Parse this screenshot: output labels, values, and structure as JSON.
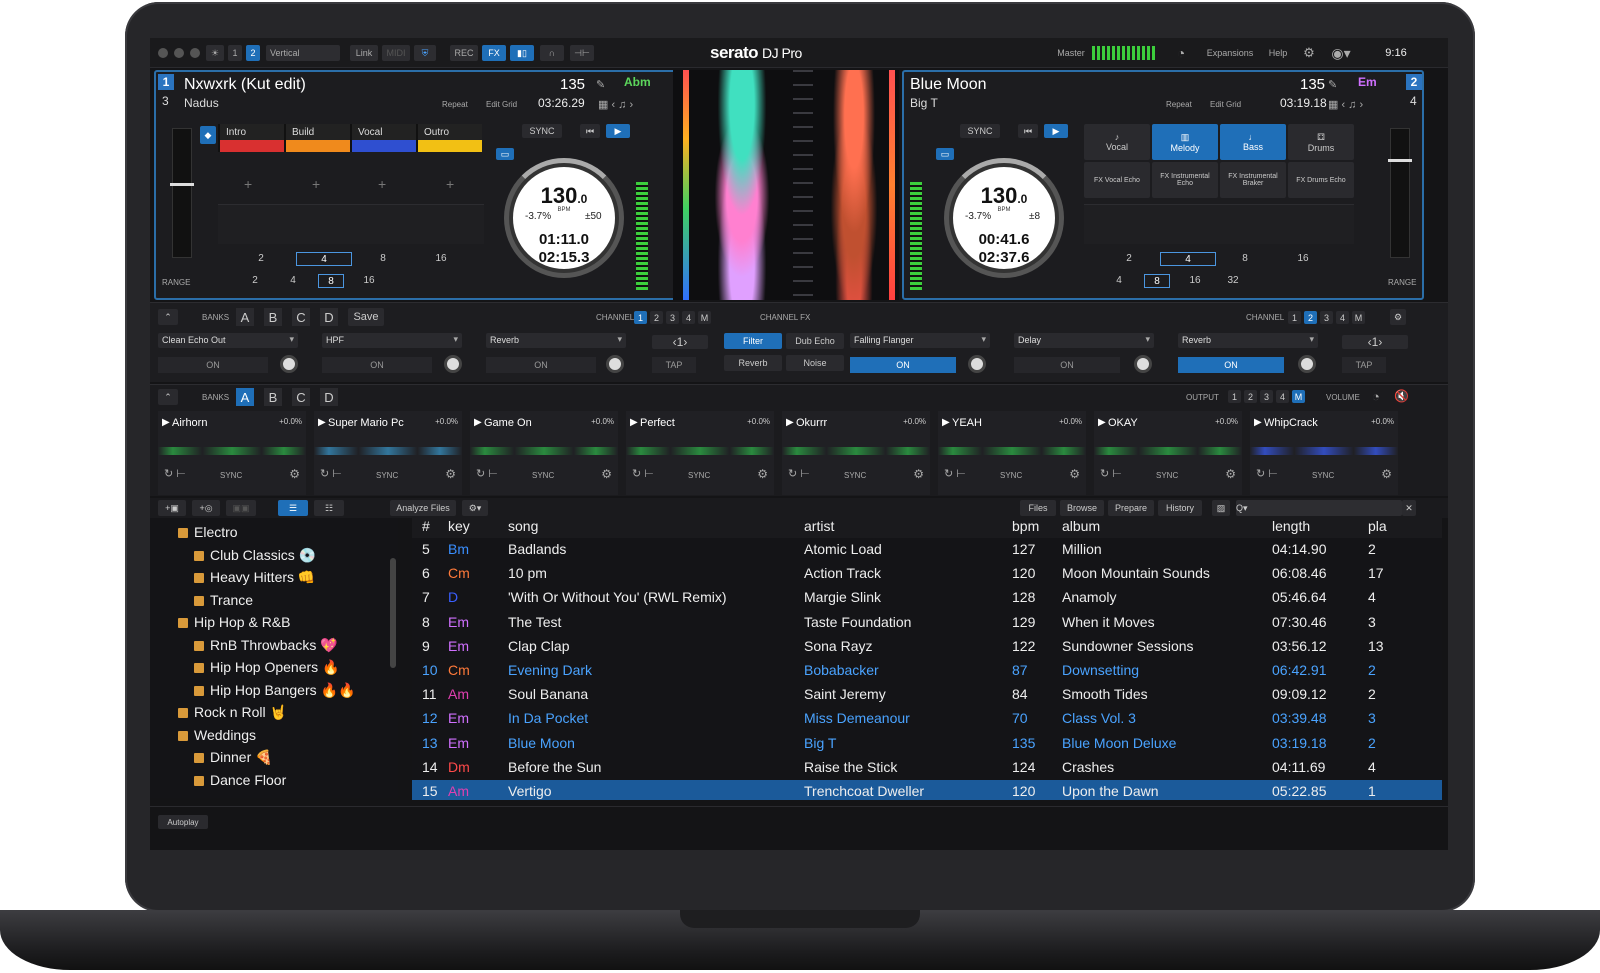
{
  "app": {
    "logo": "serato",
    "logo_suffix": "DJ Pro",
    "layout": "Vertical",
    "link": "Link",
    "midi": "MIDI",
    "rec": "REC",
    "fx": "FX",
    "master": "Master",
    "expansions": "Expansions",
    "help": "Help",
    "clock": "9:16",
    "deck_views": [
      "1",
      "2"
    ]
  },
  "deck1": {
    "num": "1",
    "num2": "3",
    "title": "Nxwxrk (Kut edit)",
    "artist": "Nadus",
    "bpm": "135",
    "key": "Abm",
    "remaining": "03:26.29",
    "repeat": "Repeat",
    "editgrid": "Edit Grid",
    "sync": "SYNC",
    "platter_bpm": "130",
    "platter_bpm_dec": ".0",
    "bpm_unit": "BPM",
    "pitch": "-3.7%",
    "range": "±50",
    "elapsed": "01:11.0",
    "remain": "02:15.3",
    "range_label": "RANGE",
    "cues": [
      {
        "label": "Intro",
        "color": "#d93030"
      },
      {
        "label": "Build",
        "color": "#f08a1c"
      },
      {
        "label": "Vocal",
        "color": "#2f4fd0"
      },
      {
        "label": "Outro",
        "color": "#f2c014"
      }
    ],
    "loops_top": [
      "2",
      "4",
      "8",
      "16"
    ],
    "loops_bot": [
      "2",
      "4",
      "8",
      "16"
    ]
  },
  "deck2": {
    "num": "2",
    "num2": "4",
    "title": "Blue Moon",
    "artist": "Big T",
    "bpm": "135",
    "key": "Em",
    "remaining": "03:19.18",
    "repeat": "Repeat",
    "editgrid": "Edit Grid",
    "sync": "SYNC",
    "platter_bpm": "130",
    "platter_bpm_dec": ".0",
    "bpm_unit": "BPM",
    "pitch": "-3.7%",
    "range": "±8",
    "elapsed": "00:41.6",
    "remain": "02:37.6",
    "range_label": "RANGE",
    "stems": [
      "Vocal",
      "Melody",
      "Bass",
      "Drums"
    ],
    "stem_fx": [
      "FX Vocal Echo",
      "FX Instrumental Echo",
      "FX Instrumental Braker",
      "FX Drums Echo"
    ],
    "loops_top": [
      "2",
      "4",
      "8",
      "16"
    ],
    "loops_bot": [
      "4",
      "8",
      "16",
      "32"
    ]
  },
  "fx": {
    "banks_label": "BANKS",
    "banks": [
      "A",
      "B",
      "C",
      "D"
    ],
    "save": "Save",
    "channel_label": "CHANNEL",
    "channels": [
      "1",
      "2",
      "3",
      "4",
      "M"
    ],
    "channel_fx": "CHANNEL FX",
    "unit1": [
      "Clean Echo Out",
      "HPF",
      "Reverb"
    ],
    "beats1": "1",
    "tap": "TAP",
    "on": "ON",
    "filter": "Filter",
    "dub_echo": "Dub Echo",
    "reverb": "Reverb",
    "noise": "Noise",
    "falling": "Falling Flanger",
    "unit2": [
      "Delay",
      "Reverb"
    ],
    "beats2": "1"
  },
  "sampler": {
    "banks_label": "BANKS",
    "banks": [
      "A",
      "B",
      "C",
      "D"
    ],
    "output": "OUTPUT",
    "volume": "VOLUME",
    "outputs": [
      "1",
      "2",
      "3",
      "4",
      "M"
    ],
    "pct": "+0.0%",
    "sync": "SYNC",
    "slots": [
      "Airhorn",
      "Super Mario Pc",
      "Game On",
      "Perfect",
      "Okurrr",
      "YEAH",
      "OKAY",
      "WhipCrack"
    ]
  },
  "library": {
    "analyze": "Analyze Files",
    "tabs": [
      "Files",
      "Browse",
      "Prepare",
      "History"
    ],
    "autoplay": "Autoplay",
    "search_placeholder": "Q▾",
    "crates": [
      {
        "name": "Electro",
        "emoji": ""
      },
      {
        "name": "Club Classics",
        "emoji": "💿"
      },
      {
        "name": "Heavy Hitters",
        "emoji": "👊"
      },
      {
        "name": "Trance",
        "emoji": ""
      },
      {
        "name": "Hip Hop & R&B",
        "emoji": ""
      },
      {
        "name": "RnB Throwbacks",
        "emoji": "💖"
      },
      {
        "name": "Hip Hop Openers",
        "emoji": "🔥"
      },
      {
        "name": "Hip Hop Bangers",
        "emoji": "🔥🔥"
      },
      {
        "name": "Rock n Roll",
        "emoji": "🤘"
      },
      {
        "name": "Weddings",
        "emoji": ""
      },
      {
        "name": "Dinner",
        "emoji": "🍕"
      },
      {
        "name": "Dance Floor",
        "emoji": ""
      }
    ],
    "columns": [
      "#",
      "key",
      "song",
      "artist",
      "bpm",
      "album",
      "length",
      "pla"
    ],
    "rows": [
      [
        "5",
        "Bm",
        "Badlands",
        "Atomic Load",
        "127",
        "Million",
        "04:14.90",
        "2"
      ],
      [
        "6",
        "Cm",
        "10 pm",
        "Action Track",
        "120",
        "Moon Mountain Sounds",
        "06:08.46",
        "17"
      ],
      [
        "7",
        "D",
        "'With Or Without You' (RWL Remix)",
        "Margie Slink",
        "128",
        "Anamoly",
        "05:46.64",
        "4"
      ],
      [
        "8",
        "Em",
        "The Test",
        "Taste Foundation",
        "129",
        "When it Moves",
        "07:30.46",
        "3"
      ],
      [
        "9",
        "Em",
        "Clap Clap",
        "Sona Rayz",
        "122",
        "Sundowner Sessions",
        "03:56.12",
        "13"
      ],
      [
        "10",
        "Cm",
        "Evening Dark",
        "Bobabacker",
        "87",
        "Downsetting",
        "06:42.91",
        "2"
      ],
      [
        "11",
        "Am",
        "Soul Banana",
        "Saint Jeremy",
        "84",
        "Smooth Tides",
        "09:09.12",
        "2"
      ],
      [
        "12",
        "Em",
        "In Da Pocket",
        "Miss Demeanour",
        "70",
        "Class Vol. 3",
        "03:39.48",
        "3"
      ],
      [
        "13",
        "Em",
        "Blue Moon",
        "Big T",
        "135",
        "Blue Moon Deluxe",
        "03:19.18",
        "2"
      ],
      [
        "14",
        "Dm",
        "Before the Sun",
        "Raise the Stick",
        "124",
        "Crashes",
        "04:11.69",
        "4"
      ],
      [
        "15",
        "Am",
        "Vertigo",
        "Trenchcoat Dweller",
        "120",
        "Upon the Dawn",
        "05:22.85",
        "1"
      ]
    ],
    "key_colors": {
      "Bm": "#3a8fff",
      "Cm": "#ff7a3a",
      "D": "#3a5fff",
      "Em": "#d070ff",
      "Am": "#e040b0",
      "Dm": "#ff4a4a"
    },
    "row_states": [
      "normal",
      "normal",
      "normal",
      "normal",
      "normal",
      "blue",
      "normal",
      "blue",
      "blue",
      "normal",
      "selected"
    ]
  }
}
